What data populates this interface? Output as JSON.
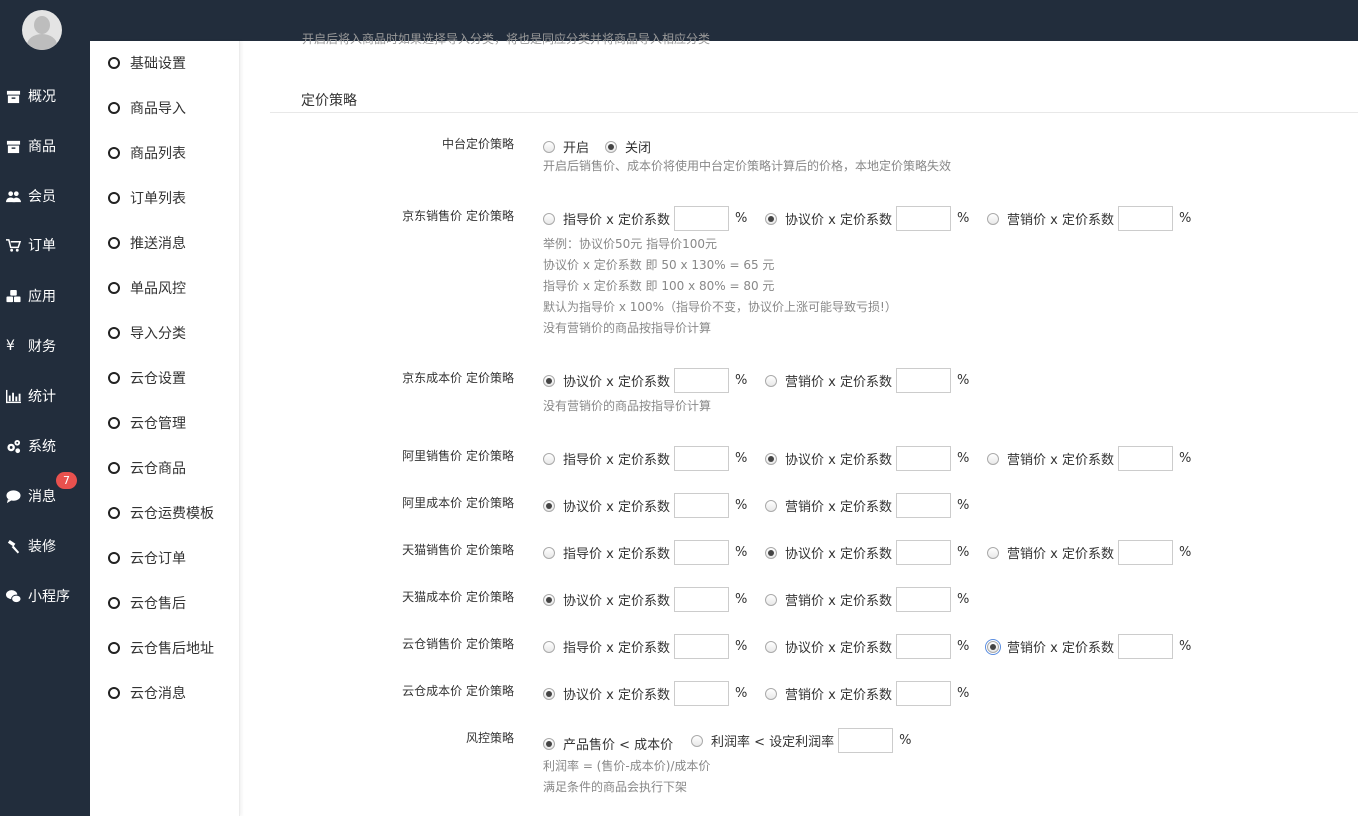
{
  "nav": {
    "items": [
      {
        "label": "概况",
        "icon": "archive-icon"
      },
      {
        "label": "商品",
        "icon": "archive-icon"
      },
      {
        "label": "会员",
        "icon": "users-icon"
      },
      {
        "label": "订单",
        "icon": "cart-icon"
      },
      {
        "label": "应用",
        "icon": "cubes-icon"
      },
      {
        "label": "财务",
        "icon": "yen-icon"
      },
      {
        "label": "统计",
        "icon": "bar-chart-icon"
      },
      {
        "label": "系统",
        "icon": "gears-icon"
      },
      {
        "label": "消息",
        "icon": "comment-icon"
      },
      {
        "label": "装修",
        "icon": "hammer-icon"
      },
      {
        "label": "小程序",
        "icon": "wechat-icon"
      }
    ],
    "message_badge": "7"
  },
  "subnav": {
    "items": [
      "基础设置",
      "商品导入",
      "商品列表",
      "订单列表",
      "推送消息",
      "单品风控",
      "导入分类",
      "云仓设置",
      "云仓管理",
      "云仓商品",
      "云仓运费模板",
      "云仓订单",
      "云仓售后",
      "云仓售后地址",
      "云仓消息"
    ]
  },
  "main": {
    "top_cut_text": "开启后将入商品时如果选择导入分类，将也是同应分类并将商品导入相应分类",
    "section_title": "定价策略",
    "center": {
      "label": "中台定价策略",
      "on": "开启",
      "off": "关闭",
      "hint": "开启后销售价、成本价将使用中台定价策略计算后的价格，本地定价策略失效"
    },
    "opt_guide": "指导价 x 定价系数",
    "opt_agree": "协议价 x 定价系数",
    "opt_market": "营销价 x 定价系数",
    "pct": "%",
    "jd_sale": {
      "label": "京东销售价 定价策略",
      "hints": [
        "举例：协议价50元 指导价100元",
        "协议价 x 定价系数 即 50 x 130% = 65 元",
        "指导价 x 定价系数 即 100 x 80% = 80 元",
        "默认为指导价 x 100%（指导价不变，协议价上涨可能导致亏损!）",
        "没有营销价的商品按指导价计算"
      ]
    },
    "jd_cost": {
      "label": "京东成本价 定价策略",
      "hint": "没有营销价的商品按指导价计算"
    },
    "ali_sale": {
      "label": "阿里销售价 定价策略"
    },
    "ali_cost": {
      "label": "阿里成本价 定价策略"
    },
    "tm_sale": {
      "label": "天猫销售价 定价策略"
    },
    "tm_cost": {
      "label": "天猫成本价 定价策略"
    },
    "yc_sale": {
      "label": "云仓销售价 定价策略"
    },
    "yc_cost": {
      "label": "云仓成本价 定价策略"
    },
    "risk": {
      "label": "风控策略",
      "opt1": "产品售价 < 成本价",
      "opt2": "利润率 < 设定利润率",
      "hints": [
        "利润率 = (售价-成本价)/成本价",
        "满足条件的商品会执行下架"
      ]
    }
  }
}
